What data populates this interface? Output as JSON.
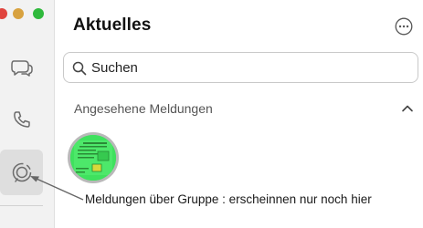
{
  "window": {
    "buttons": {
      "close": "close",
      "minimize": "minimize",
      "maximize": "maximize"
    }
  },
  "sidebar": {
    "items": [
      {
        "name": "chats",
        "icon": "chat-bubbles-icon",
        "active": false
      },
      {
        "name": "calls",
        "icon": "phone-icon",
        "active": false
      },
      {
        "name": "updates",
        "icon": "status-icon",
        "active": true
      }
    ]
  },
  "header": {
    "title": "Aktuelles",
    "more_icon": "ellipsis-circle-icon"
  },
  "search": {
    "placeholder": "Suchen",
    "icon": "search-icon"
  },
  "section": {
    "title": "Angesehene Meldungen",
    "collapse_icon": "chevron-up-icon"
  },
  "caption": "Meldungen über Gruppe : erscheinnen nur noch hier",
  "colors": {
    "sidebar_bg": "#f2f2f2",
    "active_bg": "#dedede",
    "status_green": "#3fe15e",
    "ring": "#b9b9b9"
  }
}
